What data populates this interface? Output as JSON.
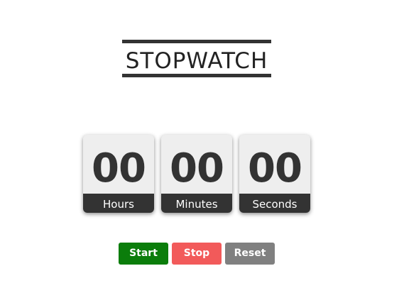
{
  "header": {
    "title": "STOPWATCH"
  },
  "timers": [
    {
      "value": "00",
      "label": "Hours"
    },
    {
      "value": "00",
      "label": "Minutes"
    },
    {
      "value": "00",
      "label": "Seconds"
    }
  ],
  "controls": {
    "start_label": "Start",
    "stop_label": "Stop",
    "reset_label": "Reset"
  },
  "colors": {
    "start": "#0b7d0b",
    "stop": "#f25a5a",
    "reset": "#808080",
    "dark": "#333333",
    "card": "#eeeeee"
  }
}
